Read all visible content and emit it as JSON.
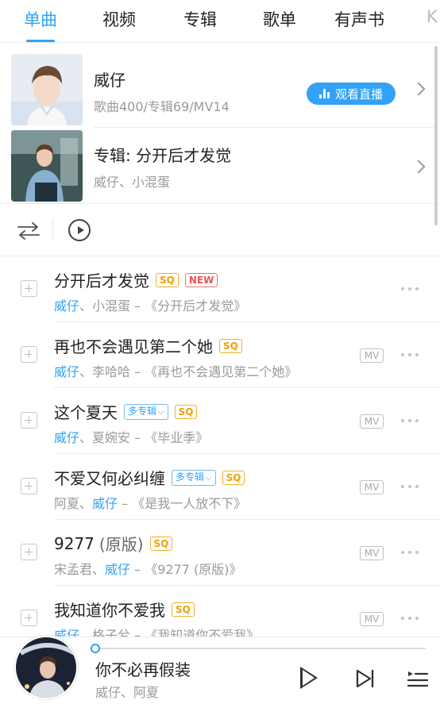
{
  "tabs": {
    "items": [
      "单曲",
      "视频",
      "专辑",
      "歌单",
      "有声书"
    ],
    "overflow": "K",
    "active_index": 0
  },
  "artist_card": {
    "name": "威仔",
    "stats": "歌曲400/专辑69/MV14",
    "live_label": "观看直播"
  },
  "album_card": {
    "title": "专辑: 分开后才发觉",
    "artists": "威仔、小混蛋"
  },
  "songs": [
    {
      "title": "分开后才发觉",
      "badges": [
        "SQ",
        "NEW"
      ],
      "artists": [
        "威仔",
        "小混蛋"
      ],
      "album": "《分开后才发觉》",
      "mv": "",
      "sq": "SQ",
      "new": "NEW"
    },
    {
      "title": "再也不会遇见第二个她",
      "artists": [
        "威仔",
        "李哈哈"
      ],
      "album": "《再也不会遇见第二个她》",
      "mv": "MV",
      "sq": "SQ"
    },
    {
      "title": "这个夏天",
      "multi": "多专辑",
      "artists": [
        "威仔",
        "夏婉安"
      ],
      "album": "《毕业季》",
      "mv": "MV",
      "sq": "SQ"
    },
    {
      "title": "不爱又何必纠缠",
      "multi": "多专辑",
      "artists": [
        "阿夏",
        "威仔"
      ],
      "album": "《是我一人放不下》",
      "mv": "MV",
      "sq": "SQ"
    },
    {
      "title": "9277",
      "title_suffix": "(原版)",
      "artists": [
        "宋孟君",
        "威仔"
      ],
      "album": "《9277 (原版)》",
      "mv": "MV",
      "sq": "SQ"
    },
    {
      "title": "我知道你不爱我",
      "artists": [
        "威仔",
        "格子兮"
      ],
      "album": "《我知道你不爱我》",
      "mv": "MV",
      "sq": "SQ"
    }
  ],
  "separators": {
    "artist_sep": "、",
    "album_sep": " – "
  },
  "player": {
    "title": "你不必再假装",
    "artist": "威仔、阿夏",
    "progress": 0.0
  },
  "icons": {
    "shuffle": "shuffle-icon",
    "play_all": "play-circle-icon",
    "add": "plus-square-icon",
    "more": "more-dots-icon",
    "play": "play-icon",
    "next": "next-track-icon",
    "playlist": "playlist-icon",
    "chevron": "chevron-right-icon"
  },
  "colors": {
    "accent": "#31a2f5",
    "sq": "#f0a000",
    "new": "#f05050",
    "muted": "#9a9a9a"
  }
}
